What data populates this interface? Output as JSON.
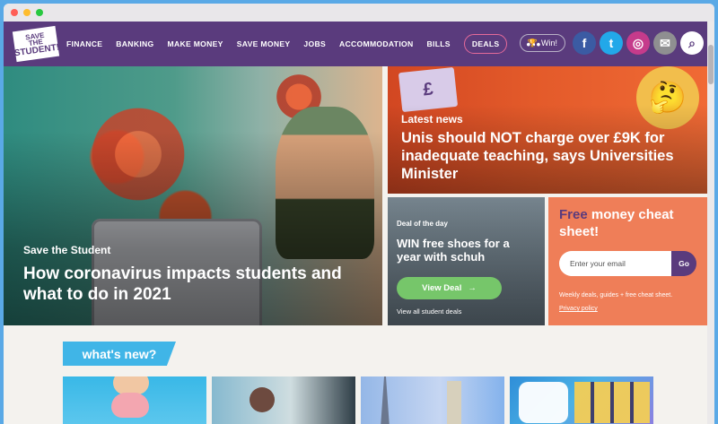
{
  "browser": {
    "dots": [
      {
        "name": "close-dot",
        "color": "#ff5f57"
      },
      {
        "name": "minimize-dot",
        "color": "#febc2e"
      },
      {
        "name": "maximize-dot",
        "color": "#28c840"
      }
    ]
  },
  "nav": {
    "logo_lines": [
      "Save",
      "the",
      "Student!"
    ],
    "items": [
      "FINANCE",
      "BANKING",
      "MAKE MONEY",
      "SAVE MONEY",
      "JOBS",
      "ACCOMMODATION",
      "BILLS",
      "DEALS"
    ],
    "more": "•••",
    "win_label": "Win!",
    "social_icons": [
      "facebook-icon",
      "twitter-icon",
      "instagram-icon",
      "mail-icon",
      "search-icon"
    ],
    "social_glyphs": [
      "f",
      "t",
      "◎",
      "✉",
      "⌕"
    ],
    "social_colors": [
      "#3b5ba3",
      "#22a8e9",
      "#c53b8b",
      "#8f8f91",
      "#ffffff"
    ],
    "accent": "#5a3b7d"
  },
  "hero": {
    "kicker": "Save the Student",
    "title": "How coronavirus impacts students and what to do in 2021"
  },
  "latest": {
    "kicker": "Latest news",
    "title": "Unis should NOT charge over £9K for inadequate teaching, says Universities Minister",
    "note_glyph": "£",
    "emoji_glyph": "🤔"
  },
  "deal": {
    "kicker": "Deal of the day",
    "title": "WIN free shoes for a year with schuh",
    "button": "View Deal",
    "button_icon": "→",
    "link": "View all student deals"
  },
  "cheat": {
    "title_accent": "Free",
    "title_rest": " money cheat sheet!",
    "placeholder": "Enter your email",
    "go": "Go",
    "small": "Weekly deals, guides + free cheat sheet.",
    "privacy": "Privacy policy"
  },
  "whats_new": {
    "label": "what's new?"
  }
}
